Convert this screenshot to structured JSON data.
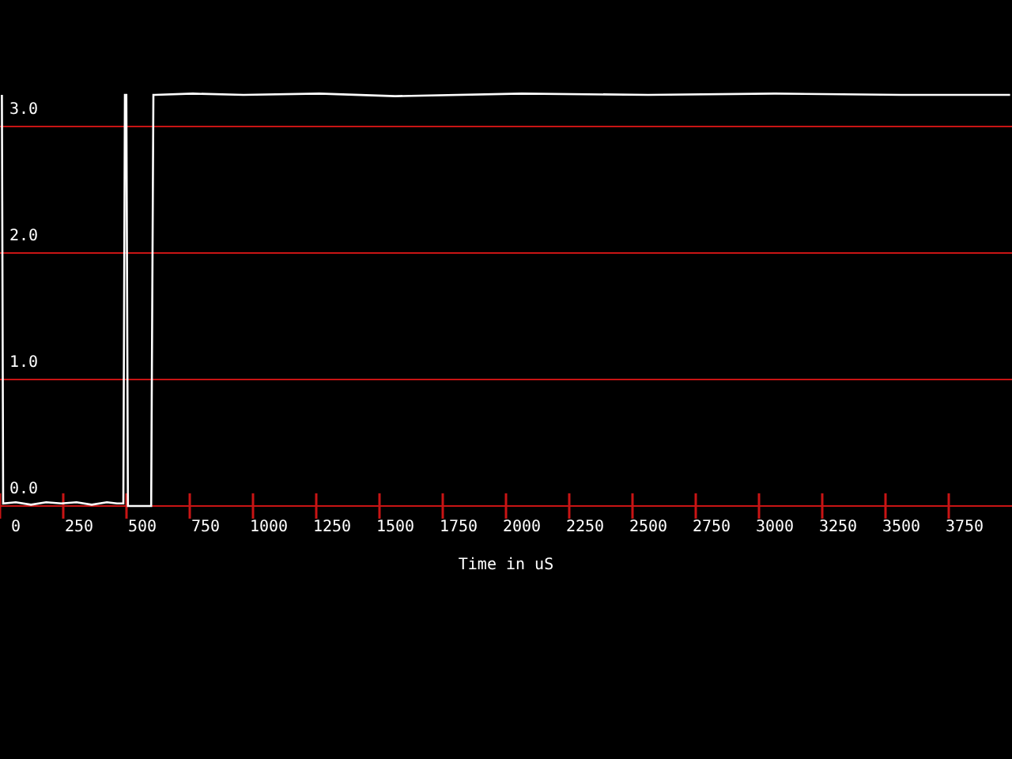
{
  "chart_data": {
    "type": "line",
    "xlabel": "Time in uS",
    "grid": true,
    "xlim": [
      -62.5,
      3937.5
    ],
    "ylim": [
      0,
      4
    ],
    "x": [
      -55,
      -50,
      0,
      60,
      120,
      180,
      240,
      300,
      360,
      400,
      425,
      431,
      437,
      443,
      449,
      455,
      500,
      535,
      544,
      550,
      700,
      900,
      1200,
      1500,
      2000,
      2500,
      3000,
      3500,
      3930
    ],
    "series": [
      {
        "color": "#ffffff",
        "values": [
          3.25,
          0.02,
          0.03,
          0.01,
          0.03,
          0.02,
          0.03,
          0.01,
          0.03,
          0.02,
          0.02,
          3.25,
          3.25,
          0.0,
          0.0,
          0.0,
          0.0,
          0.0,
          3.25,
          3.25,
          3.26,
          3.25,
          3.26,
          3.24,
          3.26,
          3.25,
          3.26,
          3.25,
          3.25
        ]
      }
    ],
    "xticks": [
      0,
      250,
      500,
      750,
      1000,
      1250,
      1500,
      1750,
      2000,
      2250,
      2500,
      2750,
      3000,
      3250,
      3500,
      3750
    ],
    "yticks": [
      {
        "value": 0,
        "label": "0.0"
      },
      {
        "value": 1,
        "label": "1.0"
      },
      {
        "value": 2,
        "label": "2.0"
      },
      {
        "value": 3,
        "label": "3.0"
      }
    ]
  }
}
